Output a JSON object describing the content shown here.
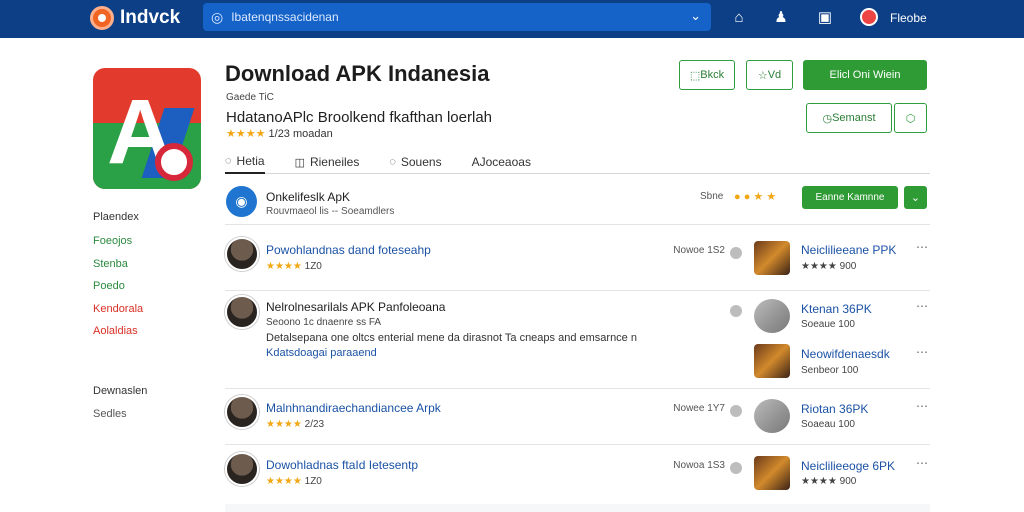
{
  "topbar": {
    "brand": "Indvck",
    "search_placeholder": "Ibatenqnssacidenan",
    "user": "Fleobe",
    "icons": [
      "headset-icon",
      "chevron-down-icon",
      "bell-icon",
      "user-icon",
      "notes-icon",
      "avatar-badge"
    ]
  },
  "app": {
    "title": "Download APK Indanesia",
    "dev": "Gaede TiC",
    "subtitle": "HdatanoAPlc Broolkend fkafthan loerlah",
    "rating_stars": "★★★★",
    "rating_text": "1/23 moadan"
  },
  "actions": {
    "back": "Bkck",
    "save": "Vd",
    "primary": "Elicl Oni Wiein",
    "semantic": "Semanst"
  },
  "tabs": [
    "Hetia",
    "Rieneiles",
    "Souens",
    "AJoceaoas"
  ],
  "sidebar": {
    "items": [
      {
        "label": "Plaendex",
        "color": "#333333"
      },
      {
        "label": "Foeojos",
        "color": "#2b8a3e"
      },
      {
        "label": "Stenba",
        "color": "#2b8a3e"
      },
      {
        "label": "Poedo",
        "color": "#2b8a3e"
      },
      {
        "label": "Kendorala",
        "color": "#d93025"
      },
      {
        "label": "Aolaldias",
        "color": "#d93025"
      }
    ],
    "footer": [
      {
        "label": "Dewnaslen"
      },
      {
        "label": "Sedles"
      }
    ]
  },
  "developer": {
    "name": "Onkelifeslk ApK",
    "meta": "Rouvmaeol lis -- Soeamdlers",
    "stat": "Sbne",
    "button": "Eanne Kamnne"
  },
  "rows": [
    {
      "title": "Powohlandnas dand foteseahp",
      "stars": "★★★★",
      "count": "1Z0",
      "meta": "Nowoe 1S2",
      "side_title": "Neiclilieeane PPK",
      "side_sub": "★★★★ 900"
    },
    {
      "title": "Nelrolnesarilals APK Panfoleoana",
      "sub": "Seoono 1c dnaenre ss FA",
      "desc": "Detalsepana one oltcs enterial mene da dirasnot Ta cneaps and emsarnce n",
      "link": "Kdatsdoagai paraaend",
      "stars": "",
      "count": "",
      "meta": "",
      "side_title": "Ktenan 36PK",
      "side_sub": "Soeaue 100",
      "side2_title": "Neowifdenaesdk",
      "side2_sub": "Senbeor 100"
    },
    {
      "title": "Malnhnandiraechandiancee Arpk",
      "stars": "★★★★",
      "count": "2/23",
      "meta": "Nowee 1Y7",
      "side_title": "Riotan 36PK",
      "side_sub": "Soaeau 100"
    },
    {
      "title": "Dowohladnas ftaId Ietesentp",
      "stars": "★★★★",
      "count": "1Z0",
      "meta": "Nowoa 1S3",
      "side_title": "Neiclilieeoge 6PK",
      "side_sub": "★★★★ 900"
    }
  ]
}
